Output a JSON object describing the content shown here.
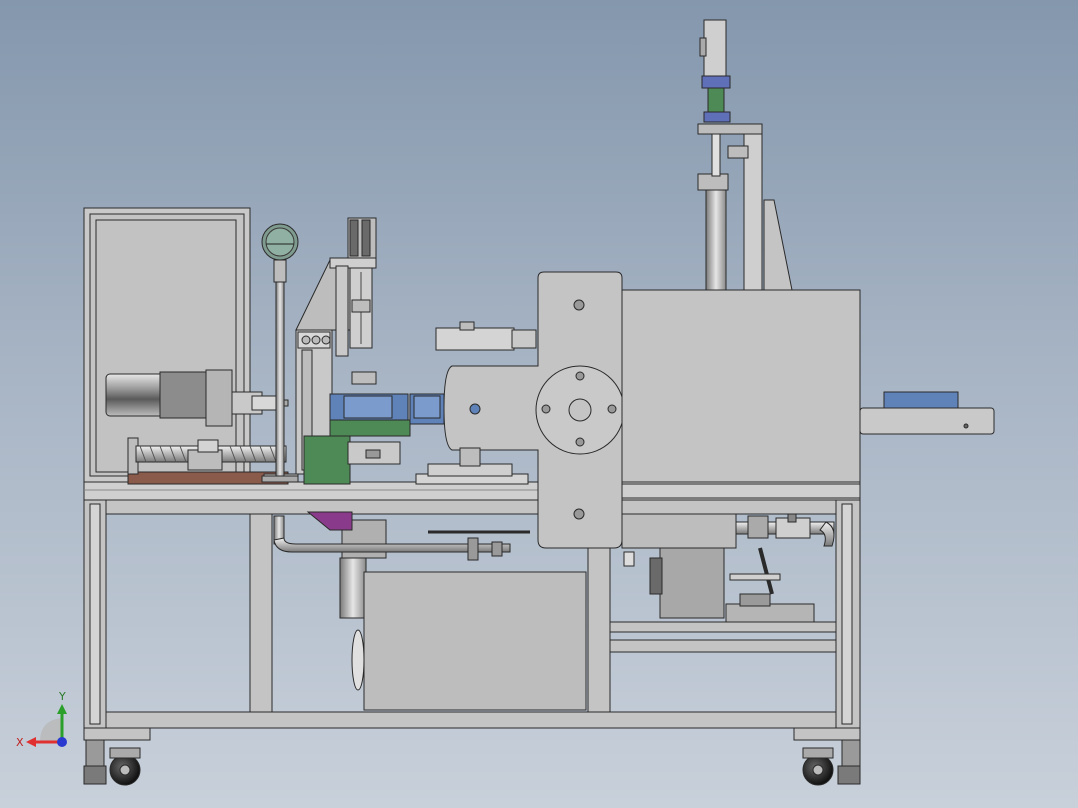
{
  "viewport": {
    "background_top": "#8497ad",
    "background_bottom": "#c8d0da"
  },
  "triad": {
    "x_label": "X",
    "y_label": "Y",
    "x_color": "#e03030",
    "y_color": "#2aa02a",
    "z_color": "#2a3ad0"
  },
  "palette": {
    "part_gray": "#c4c4c4",
    "part_dark": "#8f8f8f",
    "edge": "#2a2a2a",
    "accent_blue": "#5f83b8",
    "accent_green": "#4d8a55",
    "accent_purple": "#8a3a8a",
    "wood_base": "#8a5a4a"
  }
}
